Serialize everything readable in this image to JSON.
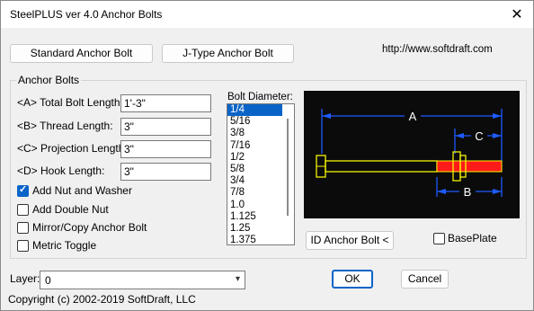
{
  "window": {
    "title": "SteelPLUS ver 4.0 Anchor Bolts",
    "close_glyph": "✕"
  },
  "toolbar": {
    "standard_label": "Standard Anchor Bolt",
    "jtype_label": "J-Type Anchor Bolt",
    "url": "http://www.softdraft.com"
  },
  "anchor_bolts": {
    "group_label": "Anchor Bolts",
    "fields": [
      {
        "label": "<A> Total Bolt Length:",
        "value": "1'-3\""
      },
      {
        "label": "<B> Thread Length:",
        "value": "3\""
      },
      {
        "label": "<C> Projection Length:",
        "value": "3\""
      },
      {
        "label": "<D> Hook Length:",
        "value": "3\""
      }
    ],
    "checkboxes": [
      {
        "label": "Add Nut and Washer",
        "checked": true
      },
      {
        "label": "Add Double Nut",
        "checked": false
      },
      {
        "label": "Mirror/Copy Anchor Bolt",
        "checked": false
      },
      {
        "label": "Metric Toggle",
        "checked": false
      }
    ]
  },
  "bolt_diameter": {
    "label": "Bolt Diameter:",
    "options": [
      "1/4",
      "5/16",
      "3/8",
      "7/16",
      "1/2",
      "5/8",
      "3/4",
      "7/8",
      "1.0",
      "1.125",
      "1.25",
      "1.375"
    ],
    "selected": "1/4"
  },
  "diagram": {
    "label_a": "A",
    "label_b": "B",
    "label_c": "C",
    "colors": {
      "background": "#0b0b0b",
      "dimension": "#1e5bff",
      "bolt": "#f5f500",
      "thread": "#ff1a1a"
    }
  },
  "id_button_label": "ID Anchor Bolt <",
  "baseplate_label": "BasePlate",
  "baseplate_checked": false,
  "layer": {
    "label": "Layer:",
    "value": "0"
  },
  "ok_label": "OK",
  "cancel_label": "Cancel",
  "copyright": "Copyright (c) 2002-2019 SoftDraft, LLC"
}
